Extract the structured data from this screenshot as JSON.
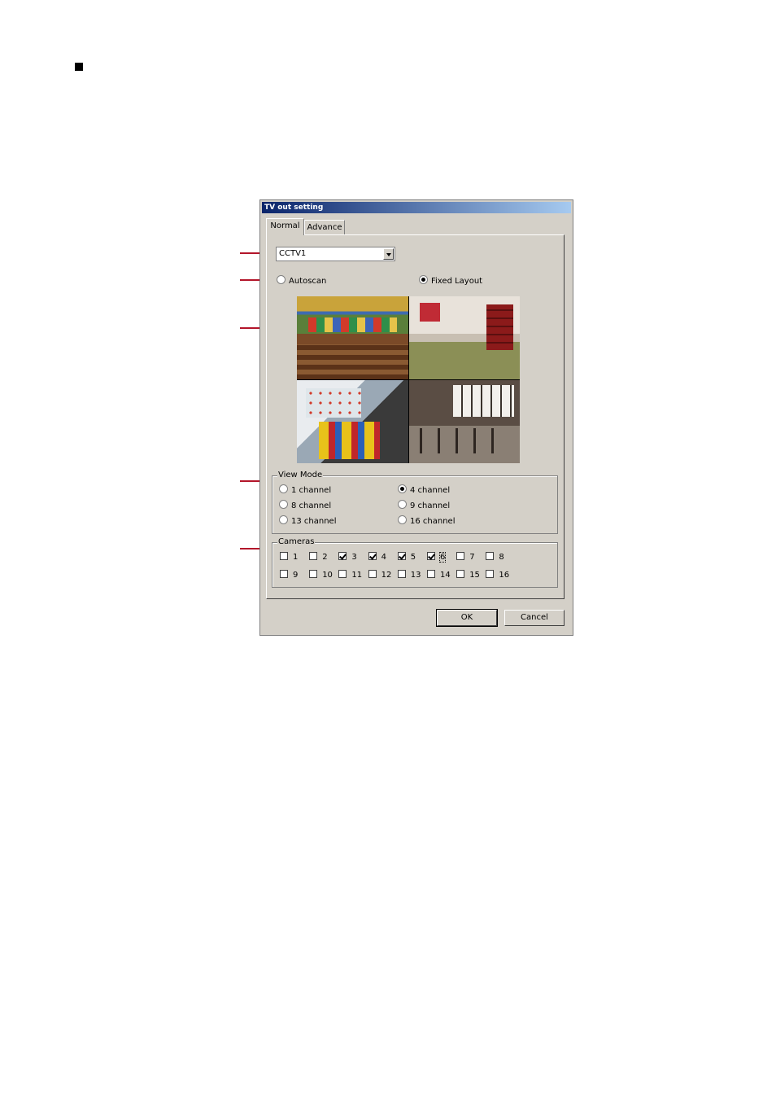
{
  "dialog": {
    "title": "TV out setting",
    "ok_label": "OK",
    "cancel_label": "Cancel"
  },
  "tabs": [
    {
      "label": "Normal",
      "active": true
    },
    {
      "label": "Advance",
      "active": false
    }
  ],
  "device_select": {
    "value": "CCTV1"
  },
  "display_mode": {
    "autoscan_label": "Autoscan",
    "fixed_layout_label": "Fixed Layout",
    "selected": "Fixed Layout"
  },
  "view_mode": {
    "label": "View Mode",
    "options": [
      {
        "label": "1 channel",
        "selected": false
      },
      {
        "label": "4 channel",
        "selected": true
      },
      {
        "label": "8 channel",
        "selected": false
      },
      {
        "label": "9 channel",
        "selected": false
      },
      {
        "label": "13 channel",
        "selected": false
      },
      {
        "label": "16 channel",
        "selected": false
      }
    ]
  },
  "cameras": {
    "label": "Cameras",
    "items": [
      {
        "label": "1",
        "checked": false
      },
      {
        "label": "2",
        "checked": false
      },
      {
        "label": "3",
        "checked": true
      },
      {
        "label": "4",
        "checked": true
      },
      {
        "label": "5",
        "checked": true
      },
      {
        "label": "6",
        "checked": true
      },
      {
        "label": "7",
        "checked": false
      },
      {
        "label": "8",
        "checked": false
      },
      {
        "label": "9",
        "checked": false
      },
      {
        "label": "10",
        "checked": false
      },
      {
        "label": "11",
        "checked": false
      },
      {
        "label": "12",
        "checked": false
      },
      {
        "label": "13",
        "checked": false
      },
      {
        "label": "14",
        "checked": false
      },
      {
        "label": "15",
        "checked": false
      },
      {
        "label": "16",
        "checked": false
      }
    ]
  },
  "colors": {
    "callout": "#b3152a",
    "titlebar_start": "#0a246a",
    "titlebar_end": "#a6caf0",
    "dialog_bg": "#d4d0c8"
  }
}
